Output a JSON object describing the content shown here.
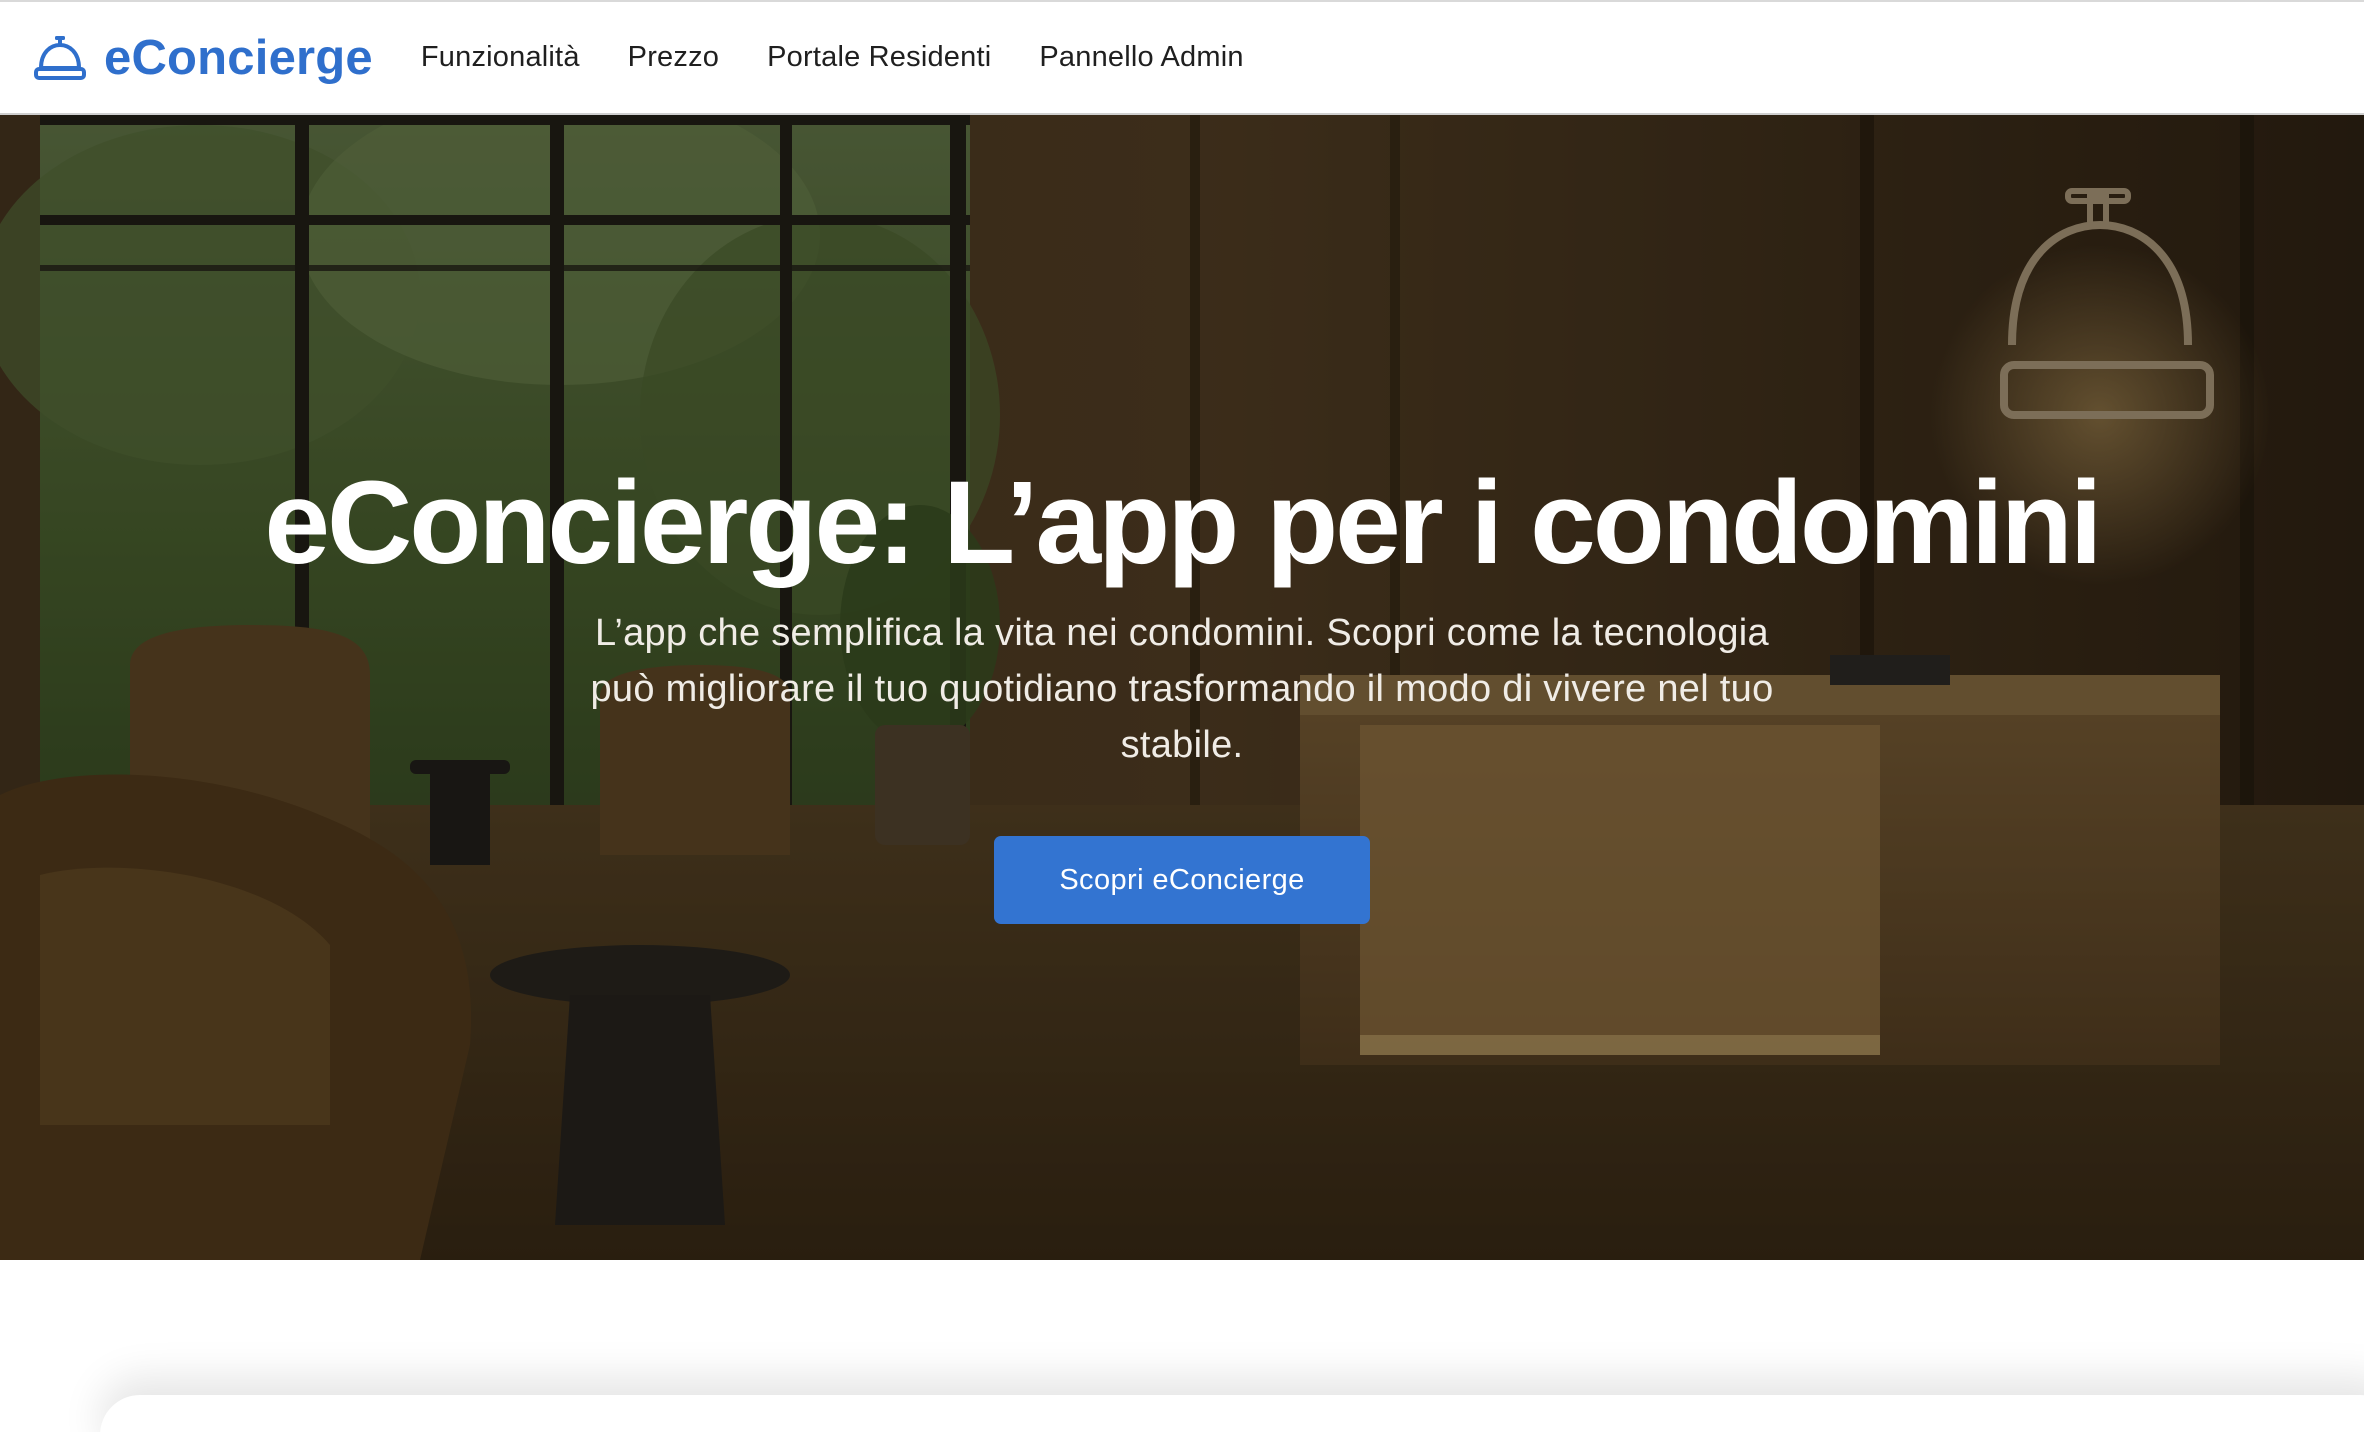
{
  "brand": {
    "name": "eConcierge",
    "icon": "service-bell-icon",
    "color": "#2f6fcc"
  },
  "nav": {
    "items": [
      {
        "label": "Funzionalità"
      },
      {
        "label": "Prezzo"
      },
      {
        "label": "Portale Residenti"
      },
      {
        "label": "Pannello Admin"
      }
    ]
  },
  "hero": {
    "title": "eConcierge: L’app per i condomini",
    "subtitle_lines": [
      "L’app che semplifica la vita nei condomini. Scopri come la tecnologia",
      "può migliorare il tuo quotidiano trasformando il modo di vivere nel tuo",
      "stabile."
    ],
    "cta_label": "Scopri eConcierge",
    "cta_color": "#3374d1",
    "background": "lobby-photo"
  }
}
